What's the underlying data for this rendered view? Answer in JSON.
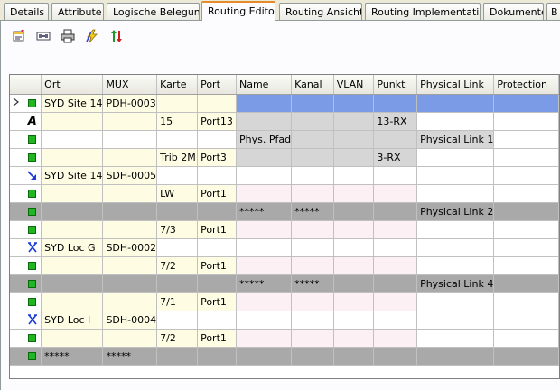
{
  "tabs": [
    "Details",
    "Attribute",
    "Logische Belegung",
    "Routing Editor",
    "Routing Ansicht",
    "Routing Implementation",
    "Dokumente",
    "B"
  ],
  "active_tab": "Routing Editor",
  "toolbar": [
    {
      "name": "properties-icon"
    },
    {
      "name": "route-icon"
    },
    {
      "name": "print-icon"
    },
    {
      "name": "lightning-icon"
    },
    {
      "name": "sort-icon"
    }
  ],
  "columns": [
    "Ort",
    "MUX",
    "Karte",
    "Port",
    "Name",
    "Kanal",
    "VLAN",
    "Punkt",
    "Physical Link",
    "Protection"
  ],
  "rows": [
    {
      "icon": "square",
      "ort": "SYD Site 14",
      "mux": "PDH-0003",
      "karte": "",
      "port": "",
      "name": "",
      "kanal": "",
      "vlan": "",
      "punkt": "",
      "plink": "",
      "prot": ""
    },
    {
      "icon": "A",
      "ort": "",
      "mux": "",
      "karte": "15",
      "port": "Port13",
      "name": "",
      "kanal": "",
      "vlan": "",
      "punkt": "13-RX",
      "plink": "",
      "prot": ""
    },
    {
      "icon": "square",
      "ort": "",
      "mux": "",
      "karte": "",
      "port": "",
      "name": "Phys. Pfad",
      "kanal": "",
      "vlan": "",
      "punkt": "",
      "plink": "Physical Link 1",
      "prot": ""
    },
    {
      "icon": "square",
      "ort": "",
      "mux": "",
      "karte": "Trib 2M",
      "port": "Port3",
      "name": "",
      "kanal": "",
      "vlan": "",
      "punkt": "3-RX",
      "plink": "",
      "prot": ""
    },
    {
      "icon": "arrow",
      "ort": "SYD Site 14",
      "mux": "SDH-0005",
      "karte": "",
      "port": "",
      "name": "",
      "kanal": "",
      "vlan": "",
      "punkt": "",
      "plink": "",
      "prot": ""
    },
    {
      "icon": "square",
      "ort": "",
      "mux": "",
      "karte": "LW",
      "port": "Port1",
      "name": "",
      "kanal": "",
      "vlan": "",
      "punkt": "",
      "plink": "",
      "prot": ""
    },
    {
      "icon": "square",
      "ort": "",
      "mux": "",
      "karte": "",
      "port": "",
      "name": "*****",
      "kanal": "*****",
      "vlan": "",
      "punkt": "",
      "plink": "Physical Link 2",
      "prot": ""
    },
    {
      "icon": "square",
      "ort": "",
      "mux": "",
      "karte": "7/3",
      "port": "Port1",
      "name": "",
      "kanal": "",
      "vlan": "",
      "punkt": "",
      "plink": "",
      "prot": ""
    },
    {
      "icon": "cross",
      "ort": "SYD Loc G",
      "mux": "SDH-0002",
      "karte": "",
      "port": "",
      "name": "",
      "kanal": "",
      "vlan": "",
      "punkt": "",
      "plink": "",
      "prot": ""
    },
    {
      "icon": "square",
      "ort": "",
      "mux": "",
      "karte": "7/2",
      "port": "Port1",
      "name": "",
      "kanal": "",
      "vlan": "",
      "punkt": "",
      "plink": "",
      "prot": ""
    },
    {
      "icon": "square",
      "ort": "",
      "mux": "",
      "karte": "",
      "port": "",
      "name": "*****",
      "kanal": "*****",
      "vlan": "",
      "punkt": "",
      "plink": "Physical Link 4",
      "prot": ""
    },
    {
      "icon": "square",
      "ort": "",
      "mux": "",
      "karte": "7/1",
      "port": "Port1",
      "name": "",
      "kanal": "",
      "vlan": "",
      "punkt": "",
      "plink": "",
      "prot": ""
    },
    {
      "icon": "cross",
      "ort": "SYD Loc I",
      "mux": "SDH-0004",
      "karte": "",
      "port": "",
      "name": "",
      "kanal": "",
      "vlan": "",
      "punkt": "",
      "plink": "",
      "prot": ""
    },
    {
      "icon": "square",
      "ort": "",
      "mux": "",
      "karte": "7/2",
      "port": "Port1",
      "name": "",
      "kanal": "",
      "vlan": "",
      "punkt": "",
      "plink": "",
      "prot": ""
    },
    {
      "icon": "square",
      "ort": "*****",
      "mux": "*****",
      "karte": "",
      "port": "",
      "name": "",
      "kanal": "",
      "vlan": "",
      "punkt": "",
      "plink": "",
      "prot": ""
    }
  ],
  "selected_row": 0,
  "colors": {
    "selection": "#7b9be6",
    "yellow": "#fefde4",
    "gray": "#d6d6d6",
    "pink": "#fdf0f4",
    "dark": "#a9a9a9",
    "tab_accent": "#e68b2c"
  }
}
